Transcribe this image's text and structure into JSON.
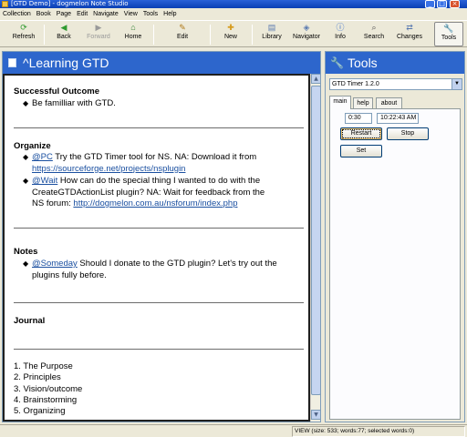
{
  "window": {
    "title": "[GTD Demo] - dogmelon Note Studio"
  },
  "menu": [
    "Collection",
    "Book",
    "Page",
    "Edit",
    "Navigate",
    "View",
    "Tools",
    "Help"
  ],
  "toolbar": {
    "refresh": "Refresh",
    "back": "Back",
    "forward": "Forward",
    "home": "Home",
    "edit": "Edit",
    "new": "New",
    "library": "Library",
    "navigator": "Navigator",
    "info": "Info",
    "search": "Search",
    "changes": "Changes",
    "tools": "Tools"
  },
  "page": {
    "title": "^Learning GTD",
    "sections": {
      "successful_outcome": {
        "heading": "Successful Outcome",
        "bullet": "Be familliar with GTD."
      },
      "organize": {
        "heading": "Organize",
        "b1_tag": "@PC",
        "b1_text": " Try the GTD Timer tool for NS. NA: Download it from",
        "b1_link": "https://sourceforge.net/projects/nsplugin",
        "b2_tag": "@Wait",
        "b2_text1": " How can do the special thing I wanted to do with the",
        "b2_text2": "CreateGTDActionList plugin? NA: Wait for feedback from the",
        "b2_text3": "NS forum: ",
        "b2_link": "http://dogmelon.com.au/nsforum/index.php"
      },
      "notes": {
        "heading": "Notes",
        "b1_tag": "@Someday",
        "b1_text1": " Should I donate to the GTD plugin? Let's try out the",
        "b1_text2": "plugins fully before."
      },
      "journal": {
        "heading": "Journal"
      },
      "list": [
        "1. The Purpose",
        "2. Principles",
        "3. Vision/outcome",
        "4. Brainstorming",
        "5. Organizing"
      ]
    }
  },
  "tools_panel": {
    "title": "Tools",
    "selected_tool": "GTD Timer 1.2.0",
    "tabs": [
      "main",
      "help",
      "about"
    ],
    "active_tab": "main",
    "timer_value": "0:30",
    "clock_value": "10:22:43 AM",
    "restart": "Restart",
    "stop": "Stop",
    "set": "Set"
  },
  "status": {
    "text": "VIEW (size: 533; words:77; selected words:0)"
  }
}
